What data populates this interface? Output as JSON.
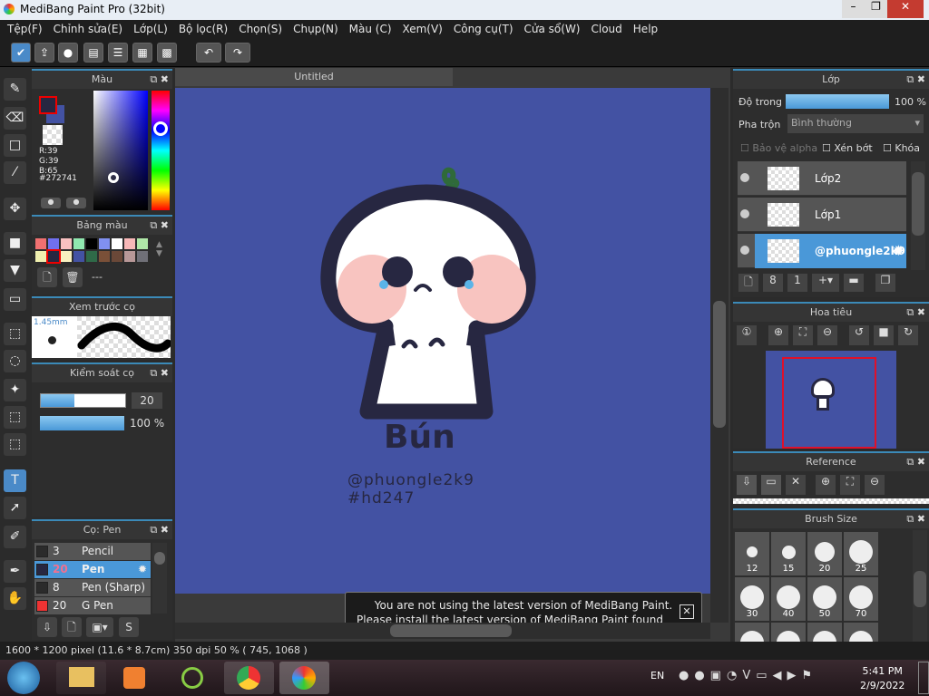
{
  "window": {
    "title": "MediBang Paint Pro (32bit)"
  },
  "menu": [
    "Tệp(F)",
    "Chỉnh sửa(E)",
    "Lớp(L)",
    "Bộ lọc(R)",
    "Chọn(S)",
    "Chụp(N)",
    "Màu (C)",
    "Xem(V)",
    "Công cụ(T)",
    "Cửa sổ(W)",
    "Cloud",
    "Help"
  ],
  "color_panel": {
    "title": "Màu",
    "r": "R:39",
    "g": "G:39",
    "b": "B:65",
    "hex": "#272741",
    "fg": "#272741",
    "bg": "#4352a3"
  },
  "palette_panel": {
    "title": "Bảng màu",
    "colors": [
      "#f07070",
      "#7070f0",
      "#f8c0c0",
      "#90e8b0",
      "#000000",
      "#8090f0",
      "#ffffff",
      "#f8b8b8",
      "#b0e8a8",
      "#f0f0b0",
      "#272741",
      "#f8f0c0",
      "#4352a3",
      "#2f6a48",
      "#7a5038",
      "#6a4838",
      "#b89898",
      "#707078"
    ],
    "label": "---"
  },
  "preview_panel": {
    "title": "Xem trước cọ",
    "size": "1.45mm"
  },
  "brush_control": {
    "title": "Kiểm soát cọ",
    "size": "20",
    "opacity": "100 %",
    "size_fraction": 0.4,
    "opacity_fraction": 1.0
  },
  "brush_panel": {
    "title": "Cọ: Pen",
    "items": [
      {
        "size": "3",
        "name": "Pencil",
        "color": "#2b2b2b"
      },
      {
        "size": "20",
        "name": "Pen",
        "color": "#272741",
        "selected": true
      },
      {
        "size": "8",
        "name": "Pen (Sharp)",
        "color": "#2b2b2b"
      },
      {
        "size": "20",
        "name": "G Pen",
        "color": "#ee3333"
      }
    ]
  },
  "canvas": {
    "tab": "Untitled",
    "drawing_title": "Bún",
    "handle": "@phuongle2k9",
    "tag": "#hd247",
    "notice_line1": "You are not using the latest version of MediBang Paint.",
    "notice_line2": "Please install the latest version of MediBang Paint found here."
  },
  "layer_panel": {
    "title": "Lớp",
    "opacity_label": "Độ trong",
    "opacity": "100 %",
    "blend_label": "Pha trộn",
    "blend": "Bình thường",
    "protect_alpha": "Bảo vệ alpha",
    "clip": "Xén bớt",
    "lock": "Khóa",
    "layers": [
      {
        "name": "Lớp2"
      },
      {
        "name": "Lớp1"
      },
      {
        "name": "@phuongle2k9",
        "selected": true
      }
    ]
  },
  "navigator": {
    "title": "Hoa tiêu"
  },
  "reference": {
    "title": "Reference"
  },
  "brush_size": {
    "title": "Brush Size",
    "sizes": [
      "12",
      "15",
      "20",
      "25",
      "30",
      "40",
      "50",
      "70"
    ]
  },
  "status": "1600 * 1200 pixel   (11.6 * 8.7cm)   350 dpi   50 %   ( 745, 1068 )",
  "taskbar": {
    "lang": "EN",
    "time": "5:41 PM",
    "date": "2/9/2022"
  }
}
